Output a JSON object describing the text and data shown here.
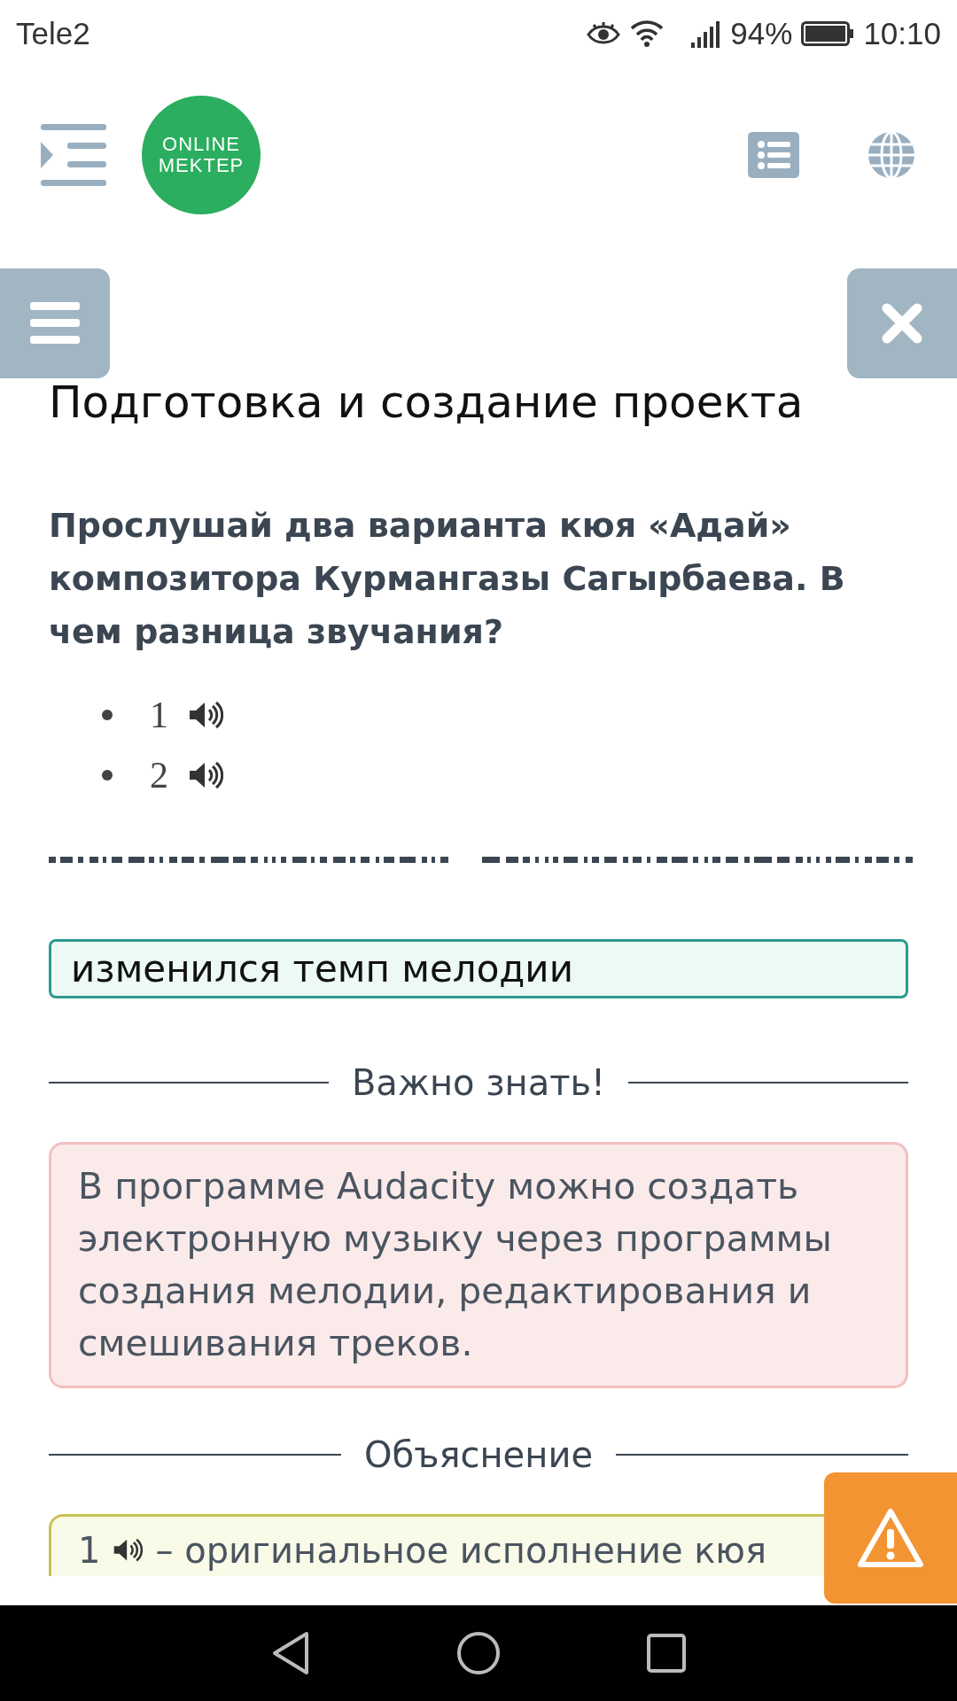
{
  "status_bar": {
    "carrier": "Tele2",
    "battery": "94%",
    "time": "10:10"
  },
  "logo": {
    "lines": [
      "ONLINE",
      "MEKTEP"
    ]
  },
  "lesson_title": "Подготовка и создание проекта",
  "question": "Прослушай два варианта кюя «Адай» композитора Курмангазы Сагырбаева. В чем разница звучания?",
  "audio_items": [
    {
      "label": "1"
    },
    {
      "label": "2"
    }
  ],
  "answer": "изменился темп мелодии",
  "important": {
    "heading": "Важно знать!",
    "text": "В программе Audacity можно создать электронную музыку через программы создания мелодии, редактирования и смешивания треков."
  },
  "explanation": {
    "heading": "Объяснение",
    "number": "1",
    "text": "– оригинальное исполнение кюя"
  }
}
